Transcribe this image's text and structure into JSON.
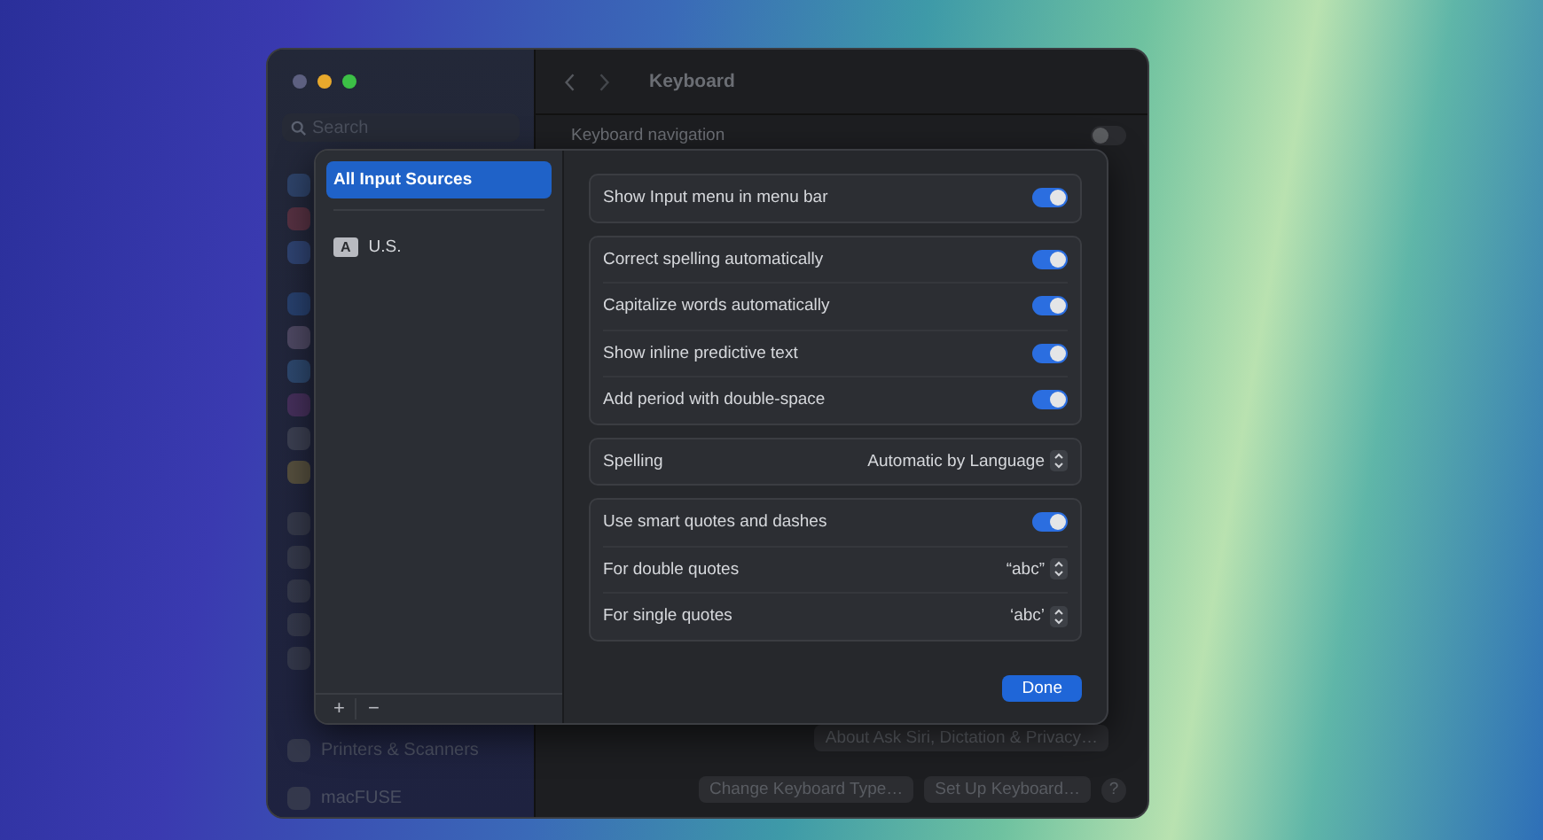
{
  "window": {
    "title": "Keyboard",
    "search": {
      "placeholder": "Search"
    },
    "sidebar": {
      "items": [
        {
          "label": "Printers & Scanners"
        },
        {
          "label": "macFUSE"
        }
      ]
    },
    "content": {
      "rows": [
        {
          "label": "Keyboard navigation",
          "on": false
        }
      ],
      "buttons": [
        "About Ask Siri, Dictation & Privacy…",
        "Change Keyboard Type…",
        "Set Up Keyboard…",
        "?"
      ]
    }
  },
  "sheet": {
    "sources": [
      {
        "label": "All Input Sources",
        "selected": true
      },
      {
        "badge": "A",
        "label": "U.S.",
        "selected": false
      }
    ],
    "list_buttons": [
      "+",
      "−"
    ],
    "groups": [
      [
        {
          "kind": "toggle",
          "label": "Show Input menu in menu bar",
          "on": true
        }
      ],
      [
        {
          "kind": "toggle",
          "label": "Correct spelling automatically",
          "on": true
        },
        {
          "kind": "toggle",
          "label": "Capitalize words automatically",
          "on": true
        },
        {
          "kind": "toggle",
          "label": "Show inline predictive text",
          "on": true
        },
        {
          "kind": "toggle",
          "label": "Add period with double-space",
          "on": true
        }
      ],
      [
        {
          "kind": "select",
          "label": "Spelling",
          "value": "Automatic by Language"
        }
      ],
      [
        {
          "kind": "toggle",
          "label": "Use smart quotes and dashes",
          "on": true
        },
        {
          "kind": "select",
          "label": "For double quotes",
          "value": "“abc”"
        },
        {
          "kind": "select",
          "label": "For single quotes",
          "value": "‘abc’"
        }
      ]
    ],
    "done": "Done"
  }
}
